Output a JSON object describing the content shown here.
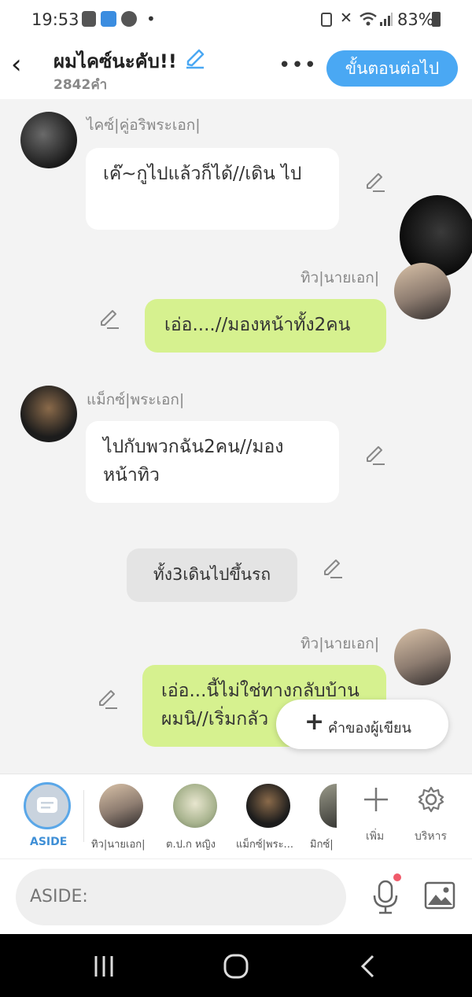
{
  "status": {
    "time": "19:53",
    "battery": "83%"
  },
  "header": {
    "title": "ผมไคซ์นะคับ!!",
    "word_count": "2842คำ",
    "more": "•••",
    "next_button": "ขั้นตอนต่อไป"
  },
  "messages": [
    {
      "type": "left",
      "name": "ไคซ์|คู่อริพระเอก|",
      "text": "เค๊~กูไปแล้วก็ได้//เดิน ไป"
    },
    {
      "type": "right",
      "name": "ทิว|นายเอก|",
      "text": "เอ่อ....//มองหน้าทั้ง2คน"
    },
    {
      "type": "left",
      "name": "แม็กซ์|พระเอก|",
      "text": "ไปกับพวกฉัน2คน//มอง หน้าทิว"
    },
    {
      "type": "narration",
      "text": "ทั้ง3เดินไปขึ้นรถ"
    },
    {
      "type": "right",
      "name": "ทิว|นายเอก|",
      "text": "เอ่อ...นี้ไม่ใช่ทางกลับบ้าน ผมนิ//เริ่มกลัว"
    }
  ],
  "author_button": {
    "plus": "+",
    "label": "คำของผู้เขียน"
  },
  "characters": {
    "aside_label": "ASIDE",
    "items": [
      {
        "label": "ทิว|นายเอก|"
      },
      {
        "label": "ต.ป.ก หญิง"
      },
      {
        "label": "แม็กซ์|พระ..."
      },
      {
        "label": "มิกซ์|"
      }
    ],
    "add_label": "เพิ่ม",
    "manage_label": "บริหาร"
  },
  "input": {
    "placeholder": "ASIDE:"
  },
  "colors": {
    "accent": "#4aa8f3",
    "my_bubble": "#d6f18f",
    "bubble": "#ffffff",
    "narration": "#e4e4e4"
  }
}
